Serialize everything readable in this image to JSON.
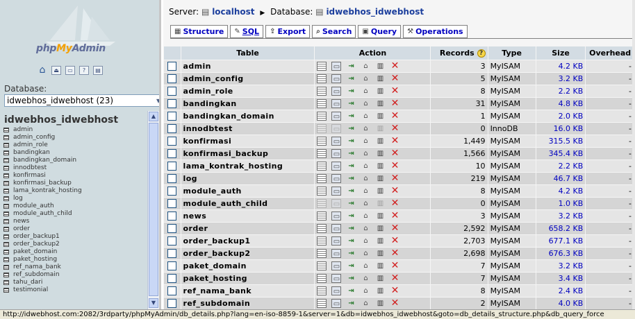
{
  "left": {
    "logo_text": "phpMyAdmin",
    "database_label": "Database:",
    "database_select_value": "idwebhos_idwebhost (23)",
    "tree_title": "idwebhos_idwebhost",
    "tree_items": [
      "admin",
      "admin_config",
      "admin_role",
      "bandingkan",
      "bandingkan_domain",
      "innodbtest",
      "konfirmasi",
      "konfirmasi_backup",
      "lama_kontrak_hosting",
      "log",
      "module_auth",
      "module_auth_child",
      "news",
      "order",
      "order_backup1",
      "order_backup2",
      "paket_domain",
      "paket_hosting",
      "ref_nama_bank",
      "ref_subdomain",
      "tahu_dari",
      "testimonial"
    ]
  },
  "breadcrumb": {
    "server_label": "Server:",
    "server": "localhost",
    "database_label": "Database:",
    "database": "idwebhos_idwebhost"
  },
  "tabs": [
    {
      "label": "Structure",
      "icon": "structure-icon"
    },
    {
      "label": "SQL",
      "icon": "sql-icon"
    },
    {
      "label": "Export",
      "icon": "export-icon"
    },
    {
      "label": "Search",
      "icon": "search-icon"
    },
    {
      "label": "Query",
      "icon": "query-icon"
    },
    {
      "label": "Operations",
      "icon": "operations-icon"
    }
  ],
  "columns": {
    "table": "Table",
    "action": "Action",
    "records": "Records",
    "type": "Type",
    "size": "Size",
    "overhead": "Overhead"
  },
  "rows": [
    {
      "name": "admin",
      "records": "3",
      "type": "MyISAM",
      "size": "4.2 KB",
      "overhead": "-"
    },
    {
      "name": "admin_config",
      "records": "5",
      "type": "MyISAM",
      "size": "3.2 KB",
      "overhead": "-"
    },
    {
      "name": "admin_role",
      "records": "8",
      "type": "MyISAM",
      "size": "2.2 KB",
      "overhead": "-"
    },
    {
      "name": "bandingkan",
      "records": "31",
      "type": "MyISAM",
      "size": "4.8 KB",
      "overhead": "-"
    },
    {
      "name": "bandingkan_domain",
      "records": "1",
      "type": "MyISAM",
      "size": "2.0 KB",
      "overhead": "-"
    },
    {
      "name": "innodbtest",
      "records": "0",
      "type": "InnoDB",
      "size": "16.0 KB",
      "overhead": "-"
    },
    {
      "name": "konfirmasi",
      "records": "1,449",
      "type": "MyISAM",
      "size": "315.5 KB",
      "overhead": "-"
    },
    {
      "name": "konfirmasi_backup",
      "records": "1,566",
      "type": "MyISAM",
      "size": "345.4 KB",
      "overhead": "-"
    },
    {
      "name": "lama_kontrak_hosting",
      "records": "10",
      "type": "MyISAM",
      "size": "2.2 KB",
      "overhead": "-"
    },
    {
      "name": "log",
      "records": "219",
      "type": "MyISAM",
      "size": "46.7 KB",
      "overhead": "-"
    },
    {
      "name": "module_auth",
      "records": "8",
      "type": "MyISAM",
      "size": "4.2 KB",
      "overhead": "-"
    },
    {
      "name": "module_auth_child",
      "records": "0",
      "type": "MyISAM",
      "size": "1.0 KB",
      "overhead": "-"
    },
    {
      "name": "news",
      "records": "3",
      "type": "MyISAM",
      "size": "3.2 KB",
      "overhead": "-"
    },
    {
      "name": "order",
      "records": "2,592",
      "type": "MyISAM",
      "size": "658.2 KB",
      "overhead": "-"
    },
    {
      "name": "order_backup1",
      "records": "2,703",
      "type": "MyISAM",
      "size": "677.1 KB",
      "overhead": "-"
    },
    {
      "name": "order_backup2",
      "records": "2,698",
      "type": "MyISAM",
      "size": "676.3 KB",
      "overhead": "-"
    },
    {
      "name": "paket_domain",
      "records": "7",
      "type": "MyISAM",
      "size": "3.2 KB",
      "overhead": "-"
    },
    {
      "name": "paket_hosting",
      "records": "7",
      "type": "MyISAM",
      "size": "3.4 KB",
      "overhead": "-"
    },
    {
      "name": "ref_nama_bank",
      "records": "8",
      "type": "MyISAM",
      "size": "2.4 KB",
      "overhead": "-"
    },
    {
      "name": "ref_subdomain",
      "records": "2",
      "type": "MyISAM",
      "size": "4.0 KB",
      "overhead": "-"
    }
  ],
  "empty_rows": [
    "innodbtest",
    "module_auth_child"
  ],
  "status_url": "http://idwebhost.com:2082/3rdparty/phpMyAdmin/db_details.php?lang=en-iso-8859-1&server=1&db=idwebhos_idwebhost&goto=db_details_structure.php&db_query_force",
  "colors": {
    "header_bg": "#d3dce3",
    "row_odd": "#e5e5e5",
    "row_even": "#d5d5d5",
    "left_bg": "#d0dce0",
    "link": "#0000c0",
    "drop_icon": "#d21f1f"
  }
}
